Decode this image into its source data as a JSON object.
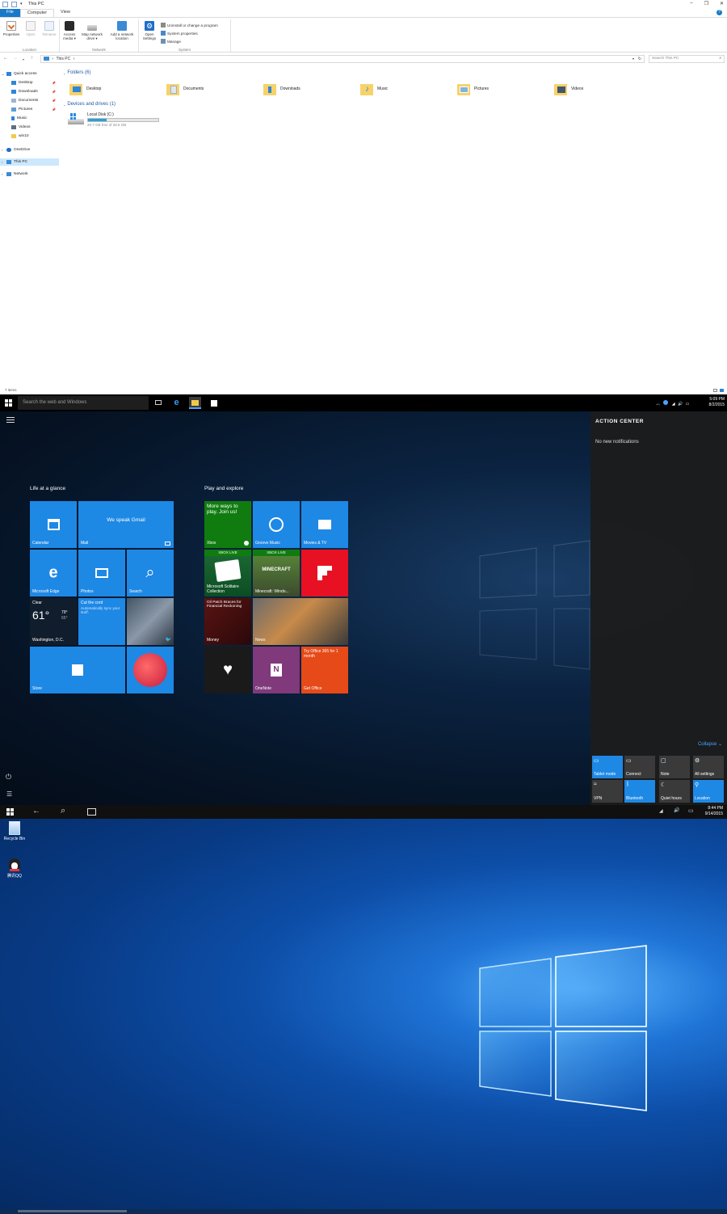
{
  "explorer": {
    "window_title": "This PC",
    "window_controls": [
      "–",
      "❐",
      "✕"
    ],
    "tabs": [
      {
        "label": "File"
      },
      {
        "label": "Computer"
      },
      {
        "label": "View"
      }
    ],
    "ribbon": {
      "location_group": "Location",
      "network_group": "Network",
      "system_group": "System",
      "properties": "Properties",
      "open": "Open",
      "rename": "Rename",
      "access_media": "Access media ▾",
      "map_network_drive": "Map network drive ▾",
      "add_network_location": "Add a network location",
      "open_settings": "Open Settings",
      "uninstall": "Uninstall or change a program",
      "system_properties": "System properties",
      "manage": "Manage"
    },
    "address": {
      "path": "This PC",
      "search_placeholder": "Search This PC"
    },
    "nav": {
      "quick_access": "Quick access",
      "desktop": "Desktop",
      "downloads": "Downloads",
      "documents": "Documents",
      "pictures": "Pictures",
      "music": "Music",
      "videos": "Videos",
      "win10": "win10",
      "onedrive": "OneDrive",
      "this_pc": "This PC",
      "network": "Network"
    },
    "folders_heading": "Folders (6)",
    "folders": [
      "Desktop",
      "Documents",
      "Downloads",
      "Music",
      "Pictures",
      "Videos"
    ],
    "devices_heading": "Devices and drives (1)",
    "drive": {
      "name": "Local Disk (C:)",
      "free_text": "20.7 GB free of 28.5 GB",
      "used_fraction": 0.27
    },
    "status": "7 items"
  },
  "start": {
    "search_placeholder": "Search the web and Windows",
    "clock_time": "5:09 PM",
    "clock_date": "8/2/2015",
    "group1": "Life at a glance",
    "group2": "Play and explore",
    "tiles": {
      "calendar": "Calendar",
      "mail_headline": "We speak Gmail",
      "mail": "Mail",
      "edge": "Microsoft Edge",
      "photos": "Photos",
      "search": "Search",
      "weather_cond": "Clear",
      "weather_temp": "61°",
      "weather_hi": "79°",
      "weather_lo": "65°",
      "weather_city": "Washington, D.C.",
      "cortana_title": "Cut the cord",
      "cortana_body": "Automatically sync your stuff.",
      "store": "Store",
      "xbox_headline": "More ways to play. Join us!",
      "xbox": "Xbox",
      "groove": "Groove Music",
      "movies": "Movies & TV",
      "xbox_live_1": "XBOX LIVE",
      "solitaire": "Microsoft Solitaire Collection",
      "xbox_live_2": "XBOX LIVE",
      "minecraft_logo": "MINECRAFT",
      "minecraft": "Minecraft: Windo...",
      "money_headline": "Oil Patch Braces for Financial Reckoning",
      "money": "Money",
      "news": "News",
      "office_headline": "Try Office 365 for 1 month",
      "onenote": "OneNote",
      "get_office": "Get Office"
    },
    "action_center": {
      "title": "ACTION CENTER",
      "empty": "No new notifications",
      "collapse": "Collapse ⌄",
      "quick_actions": [
        "Tablet mode",
        "Connect",
        "Note",
        "All settings",
        "VPN",
        "Bluetooth",
        "Quiet hours",
        "Location"
      ]
    }
  },
  "desktop": {
    "clock_time": "8:44 PM",
    "clock_date": "9/14/2015",
    "icons": [
      "Recycle Bin",
      "腾讯QQ"
    ]
  }
}
